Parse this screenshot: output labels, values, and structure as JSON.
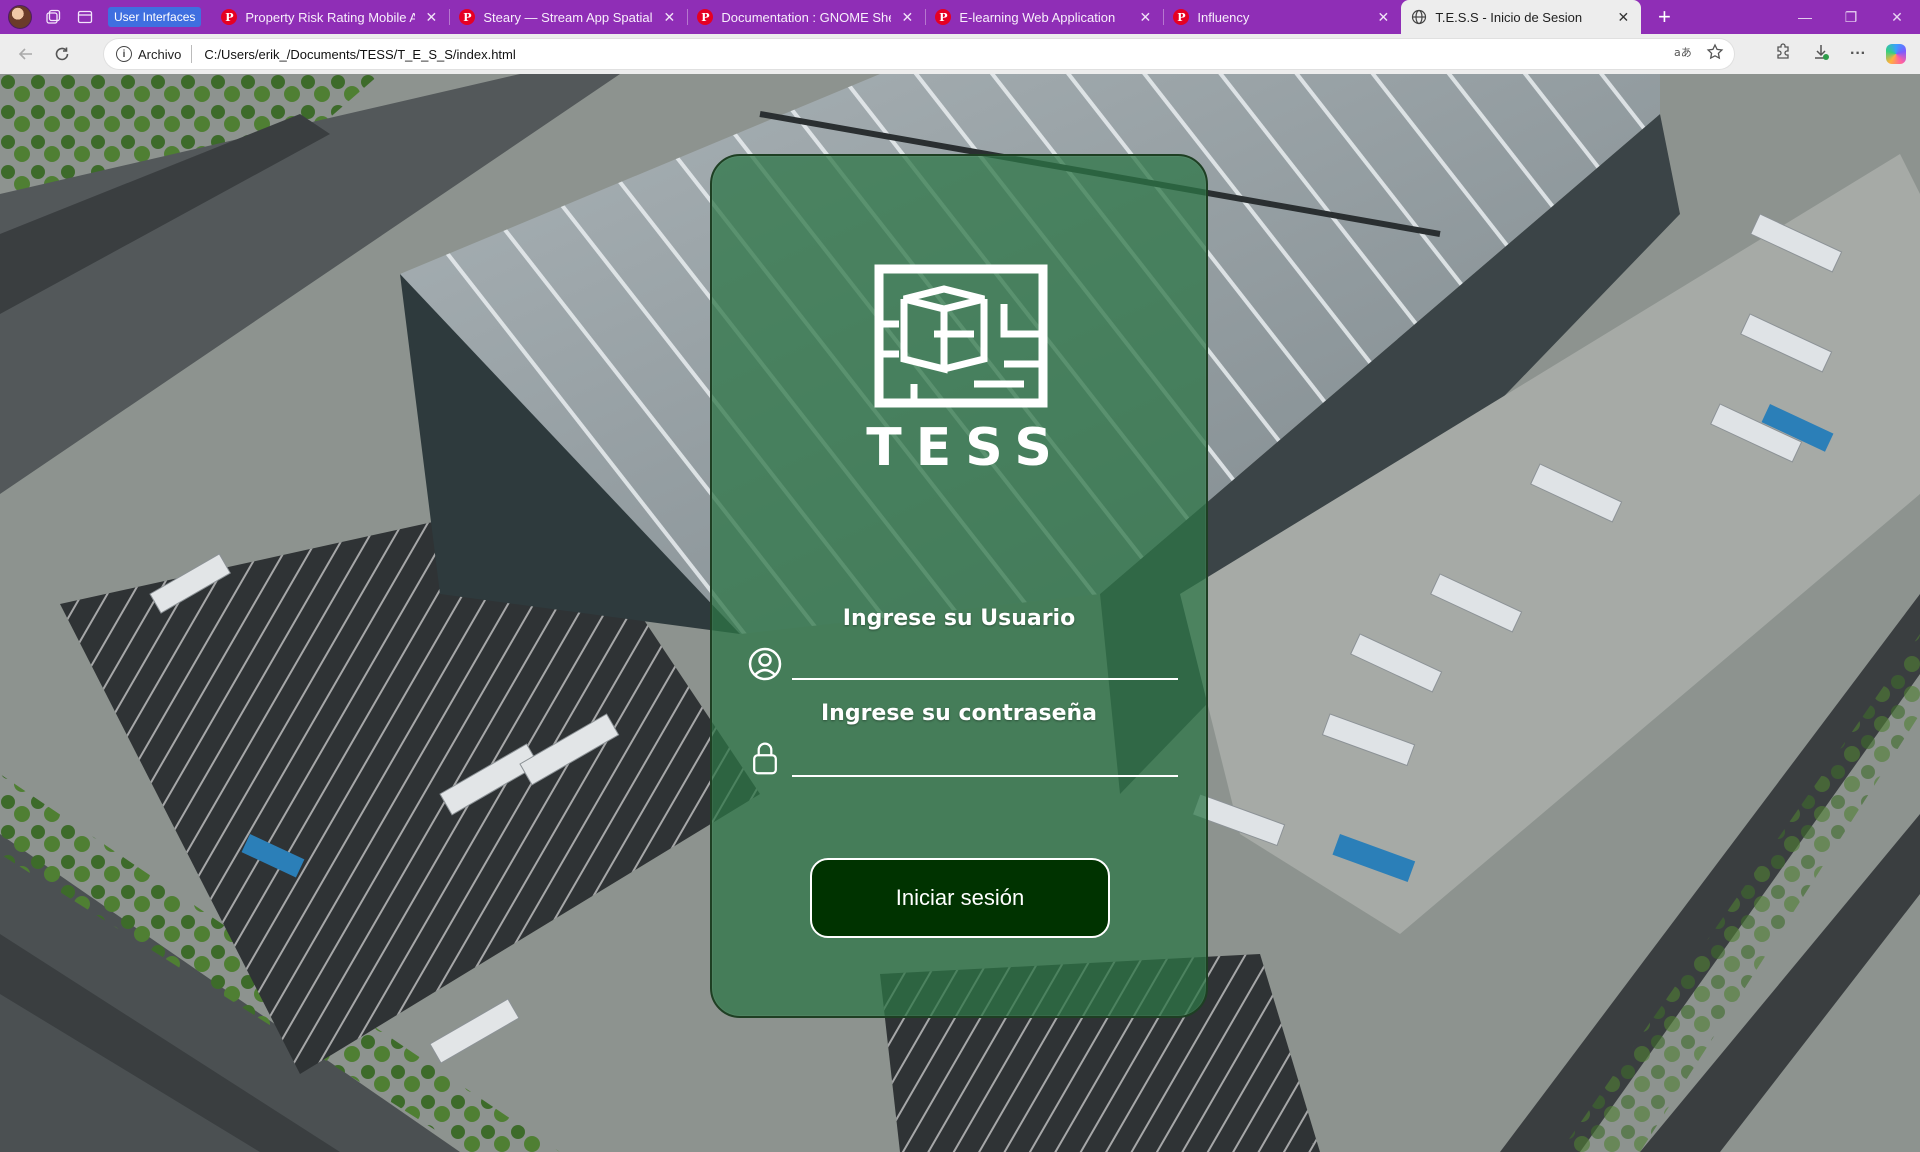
{
  "browser": {
    "tab_group_label": "User Interfaces",
    "tabs": [
      {
        "title": "Property Risk Rating Mobile App",
        "icon": "pinterest-icon",
        "active": false
      },
      {
        "title": "Steary — Stream App Spatial UI C",
        "icon": "pinterest-icon",
        "active": false
      },
      {
        "title": "Documentation : GNOME Shell w",
        "icon": "pinterest-icon",
        "active": false
      },
      {
        "title": "E-learning Web Application",
        "icon": "pinterest-icon",
        "active": false
      },
      {
        "title": "Influency",
        "icon": "pinterest-icon",
        "active": false
      },
      {
        "title": "T.E.S.S - Inicio de Sesion",
        "icon": "globe-icon",
        "active": true
      }
    ],
    "pinterest_glyph": "P",
    "site_info_label": "Archivo",
    "url": "C:/Users/erik_/Documents/TESS/T_E_S_S/index.html",
    "accent_color": "#8f2eb6"
  },
  "page": {
    "brand_name": "TESS",
    "username_label": "Ingrese su Usuario",
    "password_label": "Ingrese su contraseña",
    "username_value": "",
    "password_value": "",
    "login_button_label": "Iniciar sesión",
    "card_color": "#2c7646",
    "button_color": "#003300"
  }
}
